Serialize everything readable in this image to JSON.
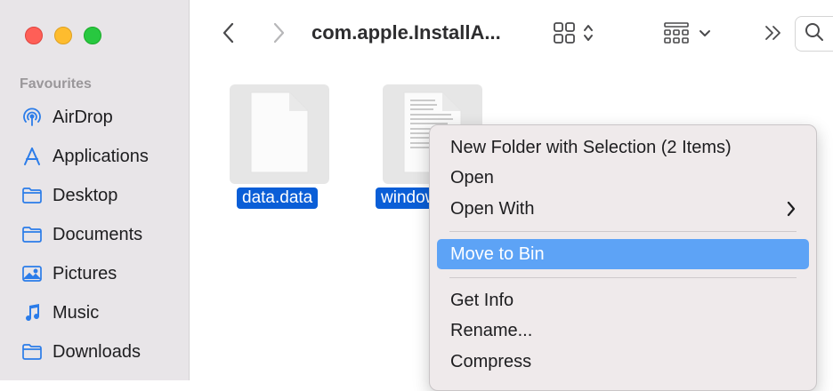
{
  "window": {
    "title": "com.apple.InstallA...",
    "traffic_lights": {
      "close": "#fe5f57",
      "minimize": "#febc2e",
      "zoom": "#28c840"
    }
  },
  "sidebar": {
    "section_title": "Favourites",
    "accent_color": "#2b7ce9",
    "items": [
      {
        "label": "AirDrop",
        "icon": "airdrop-icon"
      },
      {
        "label": "Applications",
        "icon": "applications-icon"
      },
      {
        "label": "Desktop",
        "icon": "folder-icon"
      },
      {
        "label": "Documents",
        "icon": "folder-icon"
      },
      {
        "label": "Pictures",
        "icon": "pictures-icon"
      },
      {
        "label": "Music",
        "icon": "music-icon"
      },
      {
        "label": "Downloads",
        "icon": "folder-icon"
      }
    ]
  },
  "toolbar": {
    "back_icon": "chevron-left-icon",
    "forward_icon": "chevron-right-icon",
    "view_icon": "grid-view-icon",
    "group_icon": "group-by-icon",
    "more_icon": "double-chevron-right-icon",
    "search_icon": "search-icon"
  },
  "files": [
    {
      "name": "data.data",
      "icon": "document-icon",
      "selected": true
    },
    {
      "name": "window",
      "icon": "pdf-document-icon",
      "selected": true
    }
  ],
  "context_menu": {
    "highlight_color": "#5da3f6",
    "items": [
      {
        "label": "New Folder with Selection (2 Items)"
      },
      {
        "label": "Open"
      },
      {
        "label": "Open With",
        "submenu": true
      },
      {
        "label": "Move to Bin",
        "highlighted": true
      },
      {
        "label": "Get Info"
      },
      {
        "label": "Rename..."
      },
      {
        "label": "Compress"
      }
    ]
  }
}
